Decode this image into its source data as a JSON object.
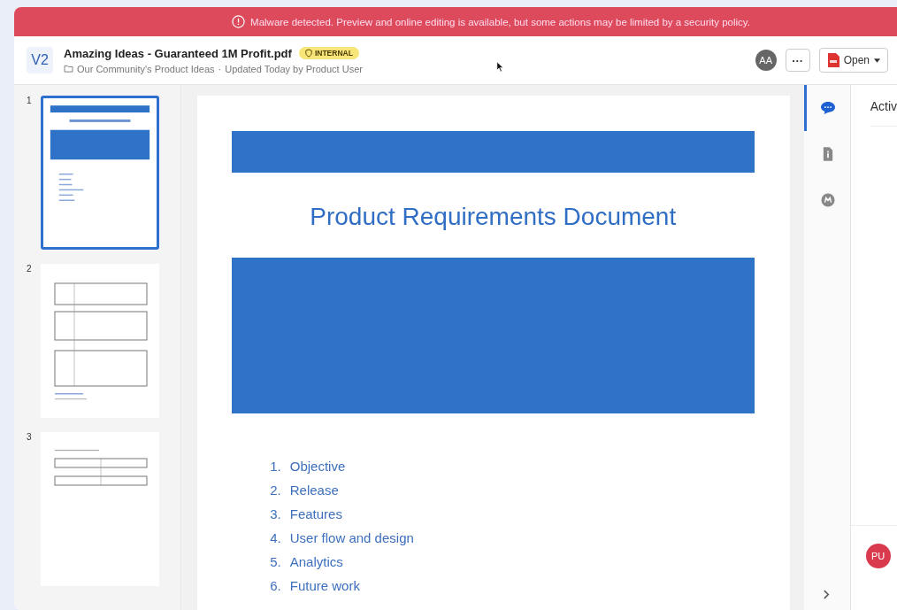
{
  "banner": {
    "text": "Malware detected. Preview and online editing is available, but some actions may be limited by a security policy."
  },
  "header": {
    "version": "V2",
    "title": "Amazing Ideas - Guaranteed 1M Profit.pdf",
    "badge": "INTERNAL",
    "folder": "Our Community's Product Ideas",
    "separator": "·",
    "updated": "Updated Today by Product User",
    "user": "AA",
    "more": "···",
    "open": "Open"
  },
  "thumbnails": [
    {
      "page": "1",
      "kind": "cover",
      "selected": true
    },
    {
      "page": "2",
      "kind": "tables",
      "selected": false
    },
    {
      "page": "3",
      "kind": "short-tables",
      "selected": false
    }
  ],
  "document": {
    "title": "Product Requirements Document",
    "list": [
      {
        "number": "1.",
        "text": "Objective"
      },
      {
        "number": "2.",
        "text": "Release"
      },
      {
        "number": "3.",
        "text": "Features"
      },
      {
        "number": "4.",
        "text": "User flow and design"
      },
      {
        "number": "5.",
        "text": "Analytics"
      },
      {
        "number": "6.",
        "text": "Future work"
      }
    ]
  },
  "side_tabs": [
    {
      "kind": "comments",
      "selected": true
    },
    {
      "kind": "info",
      "selected": false
    },
    {
      "kind": "metadata",
      "selected": false
    }
  ],
  "activity": {
    "title": "Activ",
    "avatar": "PU"
  }
}
